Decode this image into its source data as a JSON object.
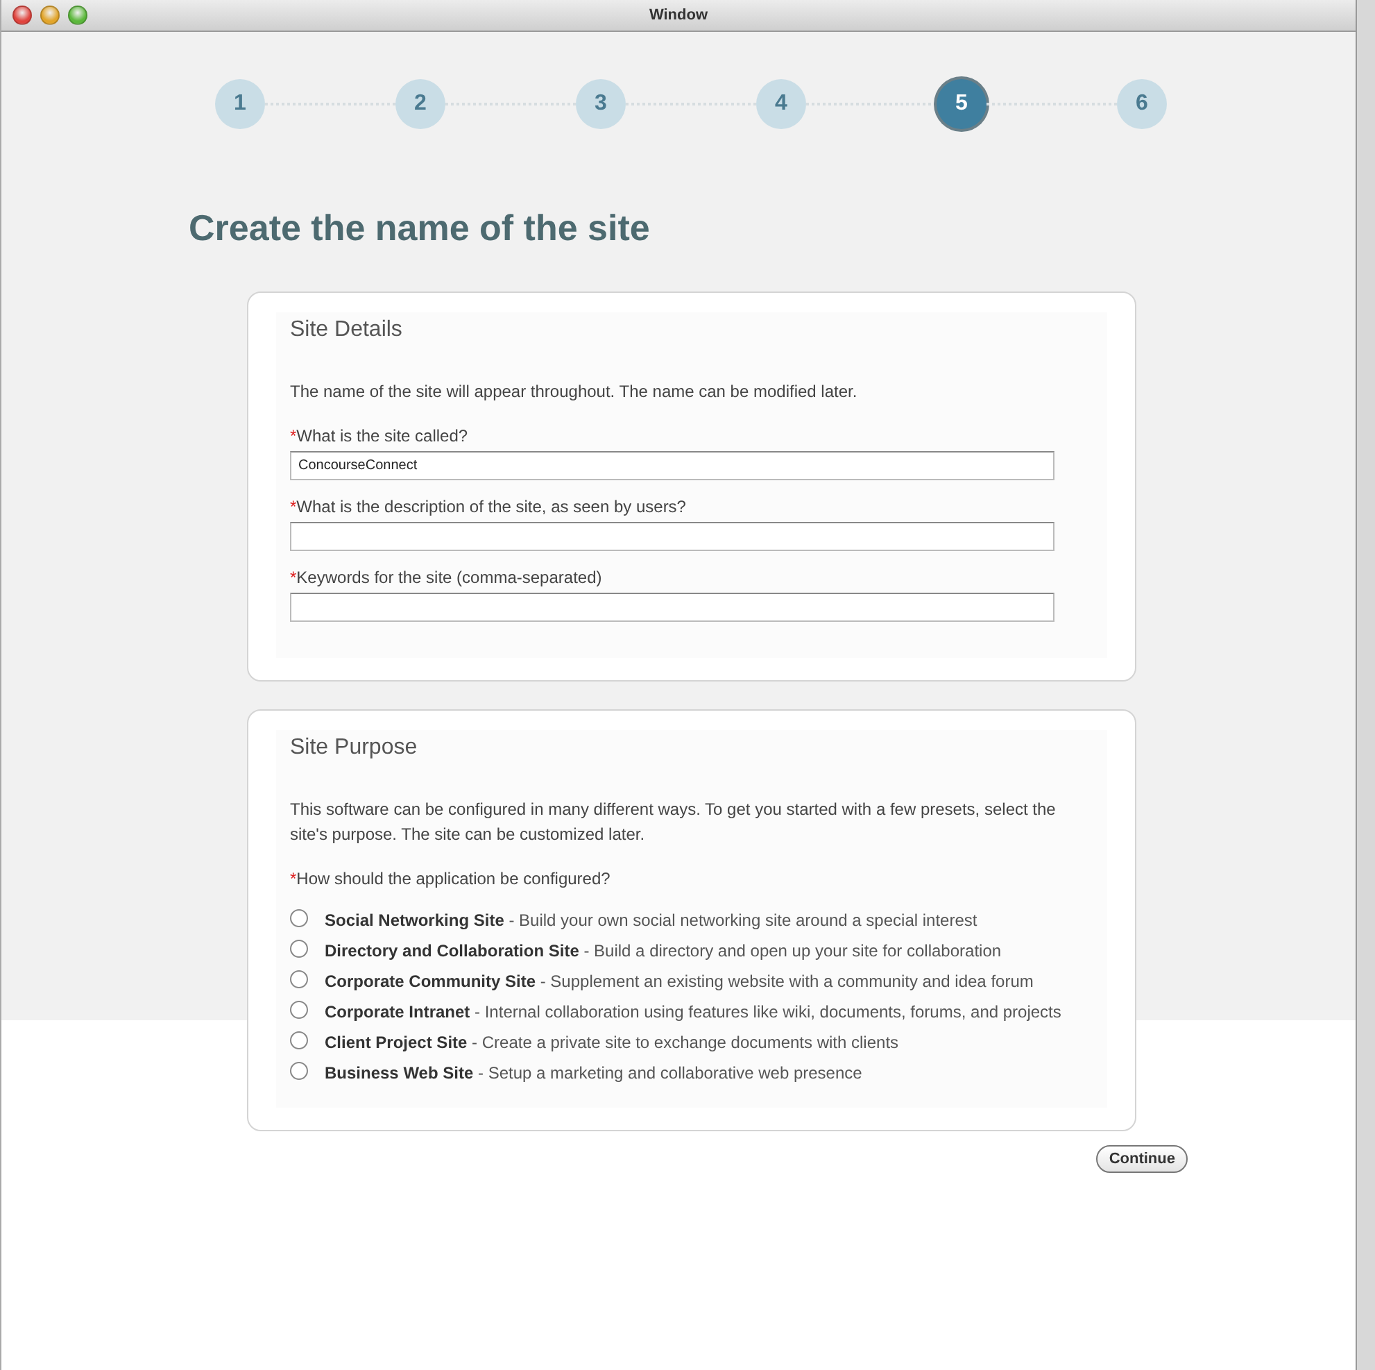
{
  "window": {
    "title": "Window"
  },
  "steps": [
    {
      "label": "1",
      "selected": false
    },
    {
      "label": "2",
      "selected": false
    },
    {
      "label": "3",
      "selected": false
    },
    {
      "label": "4",
      "selected": false
    },
    {
      "label": "5",
      "selected": true
    },
    {
      "label": "6",
      "selected": false
    }
  ],
  "heading": "Create the name of the site",
  "site_details": {
    "title": "Site Details",
    "intro": "The name of the site will appear throughout. The name can be modified later.",
    "fields": [
      {
        "required_mark": "*",
        "label": "What is the site called?",
        "value": "ConcourseConnect"
      },
      {
        "required_mark": "*",
        "label": "What is the description of the site, as seen by users?"
      },
      {
        "required_mark": "*",
        "label": "Keywords for the site (comma-separated)"
      }
    ]
  },
  "site_purpose": {
    "title": "Site Purpose",
    "intro": "This software can be configured in many different ways. To get you started with a few presets, select the site's purpose. The site can be customized later.",
    "question_mark": "*",
    "question": "How should the application be configured?",
    "options": [
      {
        "text": "**Social Networking Site** - Build your own social networking site around a special interest",
        "selected": false
      },
      {
        "text": "**Directory and Collaboration Site** - Build a directory and open up your site for collaboration",
        "selected": false
      },
      {
        "text": "**Corporate Community Site** - Supplement an existing website with a community and idea forum",
        "selected": false
      },
      {
        "text": "**Corporate Intranet** - Internal collaboration using features like wiki, documents, forums, and projects",
        "selected": false
      },
      {
        "text": "**Client Project Site** - Create a private site to exchange documents with clients",
        "selected": false
      },
      {
        "text": "**Business Web Site** - Setup a marketing and collaborative web presence",
        "selected": false
      }
    ]
  },
  "continue_button": "Continue"
}
